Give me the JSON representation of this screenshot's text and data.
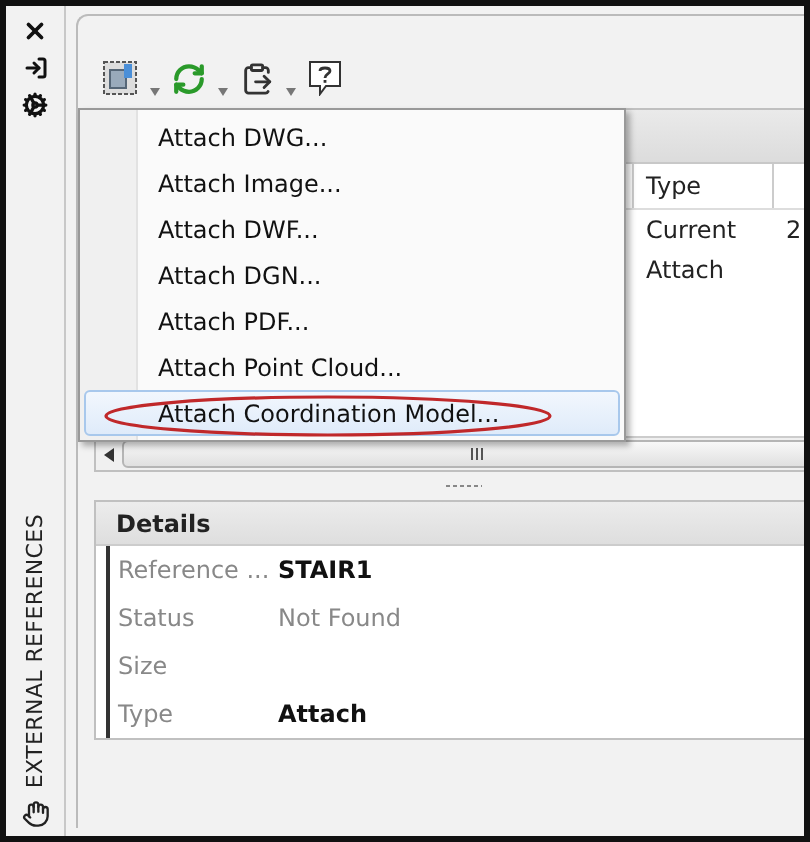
{
  "panel_title": "EXTERNAL REFERENCES",
  "menu": {
    "items": [
      {
        "label": "Attach DWG...",
        "selected": false
      },
      {
        "label": "Attach Image...",
        "selected": false
      },
      {
        "label": "Attach DWF...",
        "selected": false
      },
      {
        "label": "Attach DGN...",
        "selected": false
      },
      {
        "label": "Attach PDF...",
        "selected": false
      },
      {
        "label": "Attach Point Cloud...",
        "selected": false
      },
      {
        "label": "Attach Coordination Model...",
        "selected": true
      }
    ]
  },
  "list": {
    "columns": [
      "Type"
    ],
    "rows": [
      {
        "type": "Current",
        "column_2": "2"
      },
      {
        "type": "Attach"
      }
    ]
  },
  "details": {
    "title": "Details",
    "properties": [
      {
        "label": "Reference ...",
        "value": "STAIR1",
        "kind": "bold"
      },
      {
        "label": "Status",
        "value": "Not Found",
        "kind": "muted"
      },
      {
        "label": "Size"
      },
      {
        "label": "Type",
        "value": "Attach",
        "kind": "bold"
      }
    ]
  }
}
